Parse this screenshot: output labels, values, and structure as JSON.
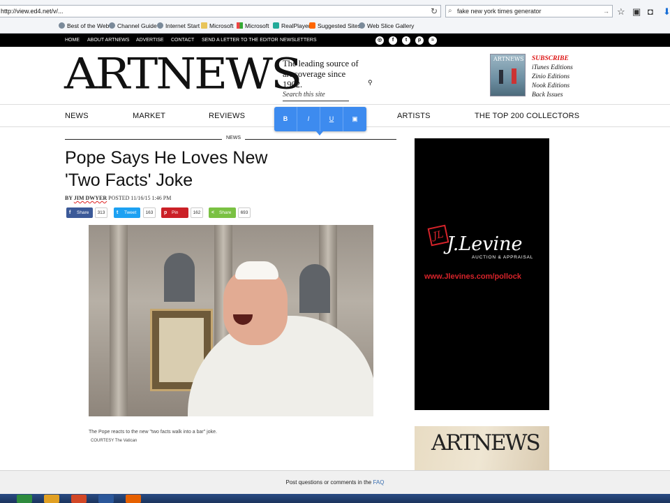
{
  "browser": {
    "url": "http://view.ed4.net/v/...",
    "search_query": "fake new york times generator",
    "favorites": [
      "Best of the Web",
      "Channel Guide",
      "Internet Start",
      "Microsoft",
      "Microsoft",
      "RealPlayer",
      "Suggested Sites",
      "Web Slice Gallery"
    ]
  },
  "topnav": {
    "items": [
      "HOME",
      "ABOUT ARTNEWS",
      "ADVERTISE",
      "CONTACT",
      "SEND A LETTER TO THE EDITOR",
      "NEWSLETTERS"
    ],
    "social": [
      "instagram-icon",
      "facebook-icon",
      "twitter-icon",
      "pinterest-icon",
      "rss-icon"
    ]
  },
  "masthead": {
    "logo": "ARTNEWS",
    "tagline": "The leading source of art coverage since 1902.",
    "search_placeholder": "Search this site",
    "subscribe": {
      "title": "SUBSCRIBE",
      "items": [
        "iTunes Editions",
        "Zinio Editions",
        "Nook Editions",
        "Back Issues"
      ]
    },
    "cover_title": "ARTNEWS"
  },
  "mainnav": {
    "items": [
      "NEWS",
      "MARKET",
      "REVIEWS",
      "ARTISTS",
      "THE TOP 200 COLLECTORS"
    ]
  },
  "format_toolbar": {
    "buttons": [
      "B",
      "I",
      "U",
      "▣"
    ]
  },
  "article": {
    "section": "NEWS",
    "headline": "Pope Says He Loves New 'Two Facts' Joke",
    "byline_prefix": "BY",
    "author": "JIM DWYER",
    "posted": "POSTED 11/16/15 1:46 PM",
    "share": [
      {
        "label": "Share",
        "count": "313",
        "color": "#3b5998",
        "icon": "f"
      },
      {
        "label": "Tweet",
        "count": "163",
        "color": "#1da1f2",
        "icon": "t"
      },
      {
        "label": "Pin",
        "count": "162",
        "color": "#cb2027",
        "icon": "p"
      },
      {
        "label": "Share",
        "count": "693",
        "color": "#7ac143",
        "icon": "<"
      }
    ],
    "caption": "The Pope reacts to the new \"two facts walk into a bar\" joke.",
    "credit": "COURTESY The Vatican"
  },
  "ad": {
    "brand_icon": "JL",
    "brand": "J.Levine",
    "sub": "AUCTION & APPRAISAL",
    "url": "www.Jlevines.com/pollock"
  },
  "ad2": {
    "logo": "ARTNEWS"
  },
  "footer": {
    "text": "Post questions or comments in the",
    "link": "FAQ"
  },
  "colors": {
    "accent_red": "#d11111",
    "toolbar_blue": "#3d8bef",
    "ad_red": "#d6232a"
  }
}
